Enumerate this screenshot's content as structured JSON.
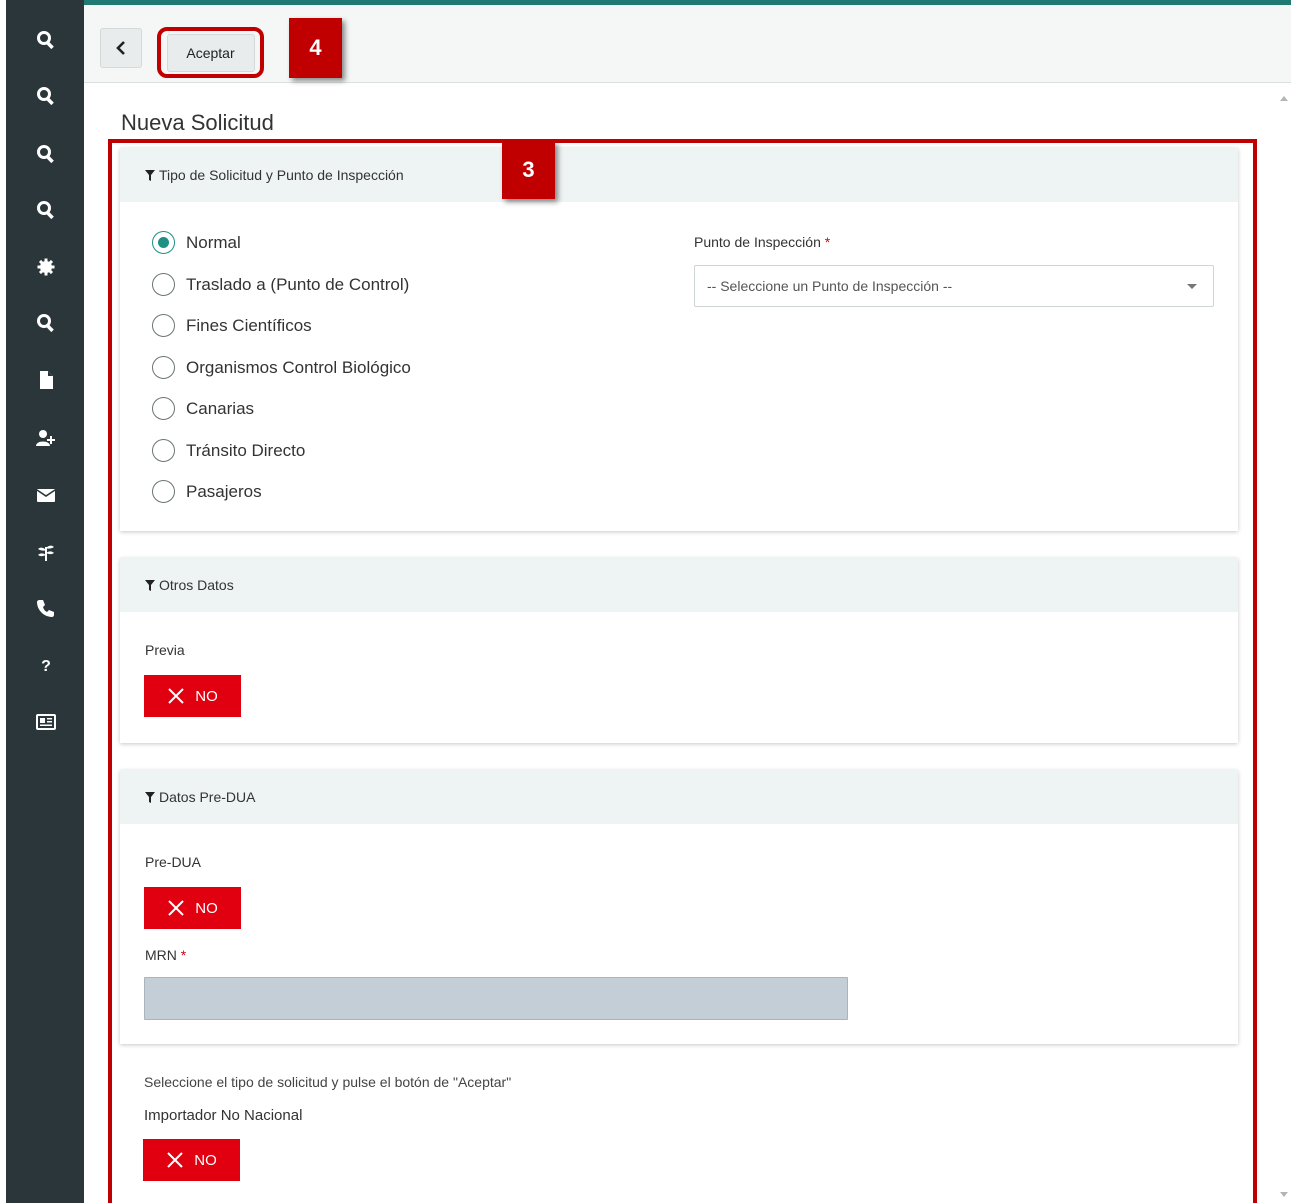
{
  "sidebar": {
    "icons": [
      "search-icon",
      "search-icon",
      "search-icon",
      "search-icon",
      "gear-icon",
      "search-icon",
      "file-icon",
      "user-add-icon",
      "envelope-icon",
      "leaf-icon",
      "phone-icon",
      "question-icon",
      "newspaper-icon"
    ]
  },
  "toolbar": {
    "back_icon": "chevron-left-icon",
    "accept_label": "Aceptar"
  },
  "annotations": {
    "step_4": "4",
    "step_3": "3"
  },
  "page": {
    "title": "Nueva Solicitud"
  },
  "section_tipo": {
    "header": "Tipo de Solicitud y Punto de Inspección",
    "options": [
      {
        "label": "Normal",
        "checked": true
      },
      {
        "label": "Traslado a (Punto de Control)",
        "checked": false
      },
      {
        "label": "Fines Científicos",
        "checked": false
      },
      {
        "label": "Organismos Control Biológico",
        "checked": false
      },
      {
        "label": "Canarias",
        "checked": false
      },
      {
        "label": "Tránsito Directo",
        "checked": false
      },
      {
        "label": "Pasajeros",
        "checked": false
      }
    ],
    "punto_label": "Punto de Inspección",
    "required_mark": "*",
    "punto_placeholder": "-- Seleccione un Punto de Inspección --"
  },
  "section_otros": {
    "header": "Otros Datos",
    "previa_label": "Previa",
    "previa_value": "NO"
  },
  "section_predua": {
    "header": "Datos Pre-DUA",
    "predua_label": "Pre-DUA",
    "predua_value": "NO",
    "mrn_label": "MRN",
    "required_mark": "*",
    "mrn_value": ""
  },
  "footer": {
    "instruction": "Seleccione el tipo de solicitud y pulse el botón de \"Aceptar\"",
    "importador_label": "Importador No Nacional",
    "importador_value": "NO"
  },
  "colors": {
    "sidebar": "#2b363b",
    "accent": "#1f7a73",
    "toggle_no": "#e00010",
    "annotation": "#c00000"
  }
}
